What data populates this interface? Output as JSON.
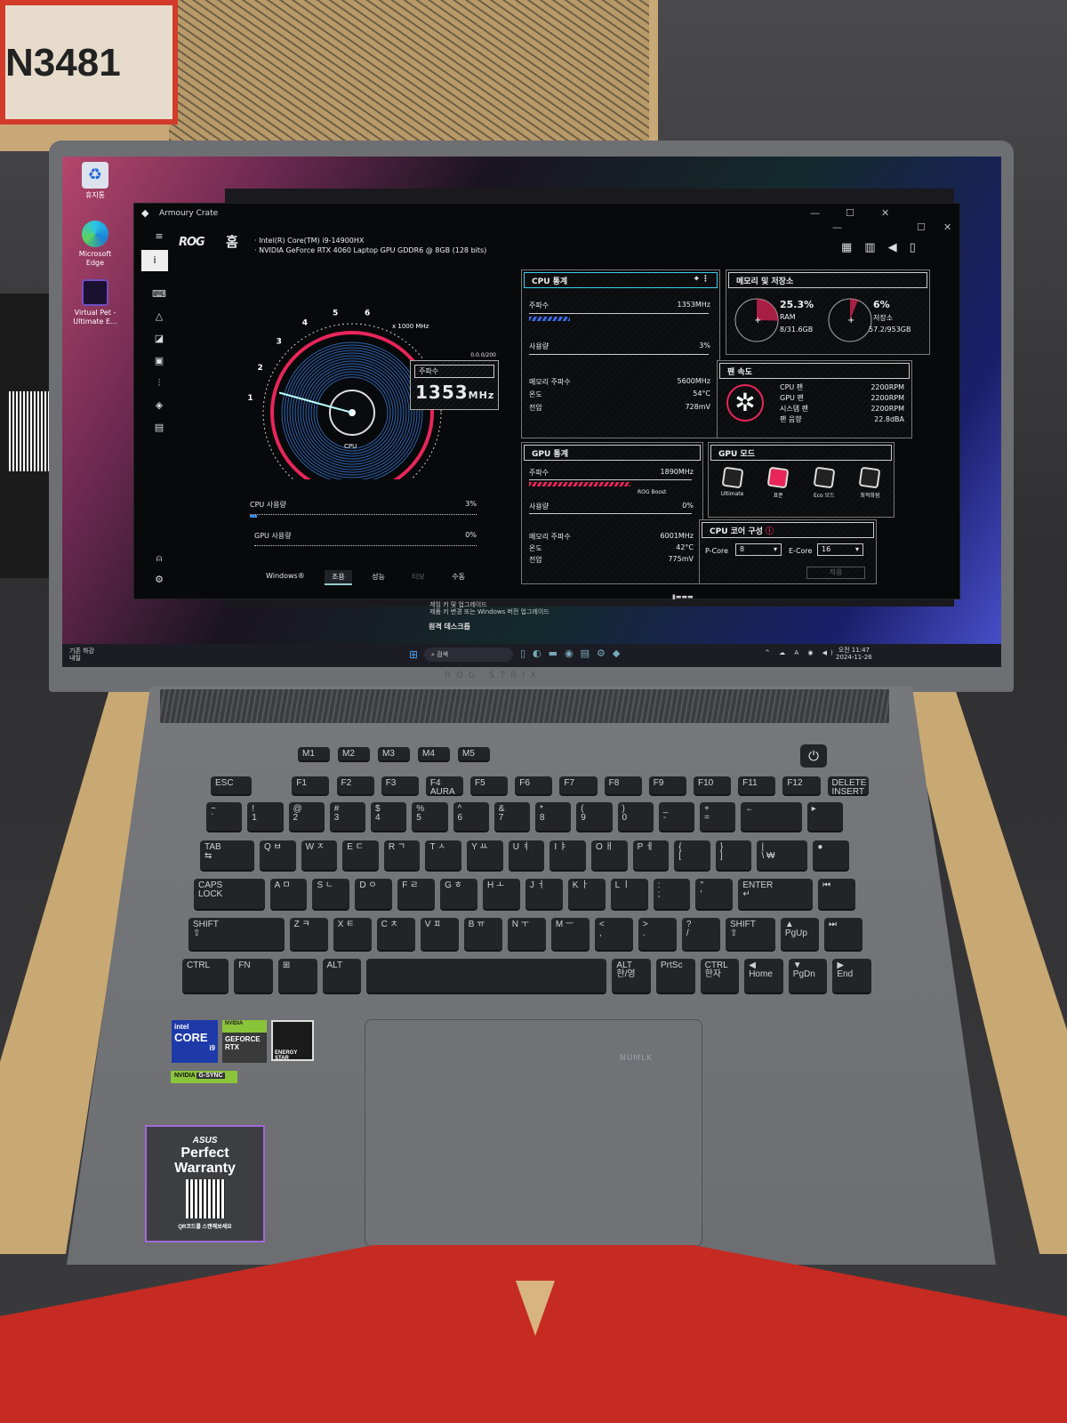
{
  "box": {
    "model_text": "N3481"
  },
  "desktop": {
    "icons": [
      {
        "label": "휴지통",
        "icon": "recycle-bin-icon"
      },
      {
        "label": "Microsoft Edge",
        "icon": "edge-icon"
      },
      {
        "label": "Virtual Pet - Ultimate E...",
        "icon": "virtual-pet-icon"
      }
    ]
  },
  "armoury": {
    "title": "Armoury Crate",
    "home": "홈",
    "cpu_name": "Intel(R) Core(TM) i9-14900HX",
    "gpu_name": "NVIDIA GeForce RTX 4060 Laptop GPU GDDR6 @ 8GB (128 bits)",
    "gauge": {
      "unit": "x 1000 MHz",
      "ticks": [
        "1",
        "2",
        "3",
        "4",
        "5",
        "6"
      ],
      "center_label": "CPU",
      "readout_label": "주파수",
      "readout_value": "1353",
      "readout_unit": "MHz",
      "tag": "0.0.0/200",
      "value_ghz": 1.353,
      "max_ghz": 6
    },
    "cpu_usage": {
      "label": "CPU 사용량",
      "value": "3%",
      "percent": 3
    },
    "gpu_usage": {
      "label": "GPU 사용량",
      "value": "0%",
      "percent": 0
    },
    "modes": [
      "Windows®",
      "조용",
      "성능",
      "터보",
      "수동"
    ],
    "active_mode": 1,
    "cpu_stats": {
      "title": "CPU 통계",
      "freq_label": "주파수",
      "freq": "1353MHz",
      "freq_percent": 23,
      "usage_label": "사용량",
      "usage": "3%",
      "usage_percent": 3,
      "mem_freq_label": "메모리 주파수",
      "mem_freq": "5600MHz",
      "temp_label": "온도",
      "temp": "54°C",
      "volt_label": "전압",
      "volt": "728mV"
    },
    "memory": {
      "title": "메모리 및 저장소",
      "ram_pct": "25.3%",
      "ram_label": "RAM",
      "ram_detail": "8/31.6GB",
      "ram_percent": 25.3,
      "storage_pct": "6%",
      "storage_label": "저장소",
      "storage_detail": "57.2/953GB",
      "storage_percent": 6
    },
    "fans": {
      "title": "팬 속도",
      "rows": [
        {
          "label": "CPU 팬",
          "value": "2200RPM"
        },
        {
          "label": "GPU 팬",
          "value": "2200RPM"
        },
        {
          "label": "시스템 팬",
          "value": "2200RPM"
        },
        {
          "label": "팬 음향",
          "value": "22.8dBA"
        }
      ]
    },
    "gpu_stats": {
      "title": "GPU 통계",
      "freq_label": "주파수",
      "freq": "1890MHz",
      "freq_percent": 60,
      "boost_label": "ROG Boost",
      "usage_label": "사용량",
      "usage": "0%",
      "mem_freq_label": "메모리 주파수",
      "mem_freq": "6001MHz",
      "temp_label": "온도",
      "temp": "42°C",
      "volt_label": "전압",
      "volt": "775mV"
    },
    "gpu_mode": {
      "title": "GPU 모드",
      "options": [
        "Ultimate",
        "표준",
        "Eco 모드",
        "최적화됨"
      ],
      "active": 1
    },
    "core_config": {
      "title": "CPU 코어 구성",
      "pcore_label": "P-Core",
      "pcore": "8",
      "ecore_label": "E-Core",
      "ecore": "16",
      "apply": "적용"
    }
  },
  "behind_window": {
    "item1_title": "게임 키 및 업그레이드",
    "item1_sub": "제품 키 변경 또는 Windows 버전 업그레이드",
    "item2": "원격 데스크톱"
  },
  "taskbar": {
    "weather": "기존 하강",
    "weather_sub": "내일",
    "search": "검색",
    "time": "오전 11:47",
    "date": "2024-11-26"
  },
  "laptop": {
    "brand_lid": "ROG STRIX",
    "touchpad_logo": "NUMLK"
  },
  "keyboard": {
    "media": [
      "M1",
      "M2",
      "M3",
      "M4",
      "M5"
    ],
    "rows": [
      [
        "ESC",
        "F1",
        "F2",
        "F3",
        "F4\nAURA",
        "F5",
        "F6",
        "F7",
        "F8",
        "F9",
        "F10",
        "F11",
        "F12",
        "DELETE\nINSERT"
      ],
      [
        "~\n`",
        "!\n1",
        "@\n2",
        "#\n3",
        "$\n4",
        "%\n5",
        "^\n6",
        "&\n7",
        "*\n8",
        "(\n9",
        ")\n0",
        "_\n-",
        "+\n=",
        "←",
        "▸"
      ],
      [
        "TAB\n⇆",
        "Q ㅂ",
        "W ㅈ",
        "E ㄷ",
        "R ㄱ",
        "T ㅅ",
        "Y ㅛ",
        "U ㅕ",
        "I ㅑ",
        "O ㅐ",
        "P ㅔ",
        "{\n[",
        "}\n]",
        "|\n\\ ₩",
        "●"
      ],
      [
        "CAPS\nLOCK",
        "A ㅁ",
        "S ㄴ",
        "D ㅇ",
        "F ㄹ",
        "G ㅎ",
        "H ㅗ",
        "J ㅓ",
        "K ㅏ",
        "L ㅣ",
        ":\n;",
        "\"\n'",
        "ENTER\n↵",
        "⏮"
      ],
      [
        "SHIFT\n⇧",
        "Z ㅋ",
        "X ㅌ",
        "C ㅊ",
        "V ㅍ",
        "B ㅠ",
        "N ㅜ",
        "M ㅡ",
        "<\n,",
        ">\n.",
        "?\n/",
        "SHIFT\n⇧",
        "▲\nPgUp",
        "⏭"
      ],
      [
        "CTRL",
        "FN",
        "⊞",
        "ALT",
        "",
        "ALT\n한/영",
        "PrtSc",
        "CTRL\n한자",
        "◀\nHome",
        "▼\nPgDn",
        "▶\nEnd"
      ]
    ]
  },
  "stickers": {
    "intel": "intel",
    "intel_core": "CORE",
    "intel_tier": "i9",
    "nvidia": "NVIDIA",
    "geforce": "GEFORCE RTX",
    "energy": "ENERGY STAR",
    "gsync": "G-SYNC",
    "asus": "ASUS",
    "warranty": "Perfect Warranty",
    "warranty_sub": "QR코드를 스캔해보세요"
  },
  "colors": {
    "accent_red": "#e8265a",
    "accent_cyan": "#3ad0e8",
    "box_red": "#c52b22",
    "cardboard": "#c8a873"
  }
}
